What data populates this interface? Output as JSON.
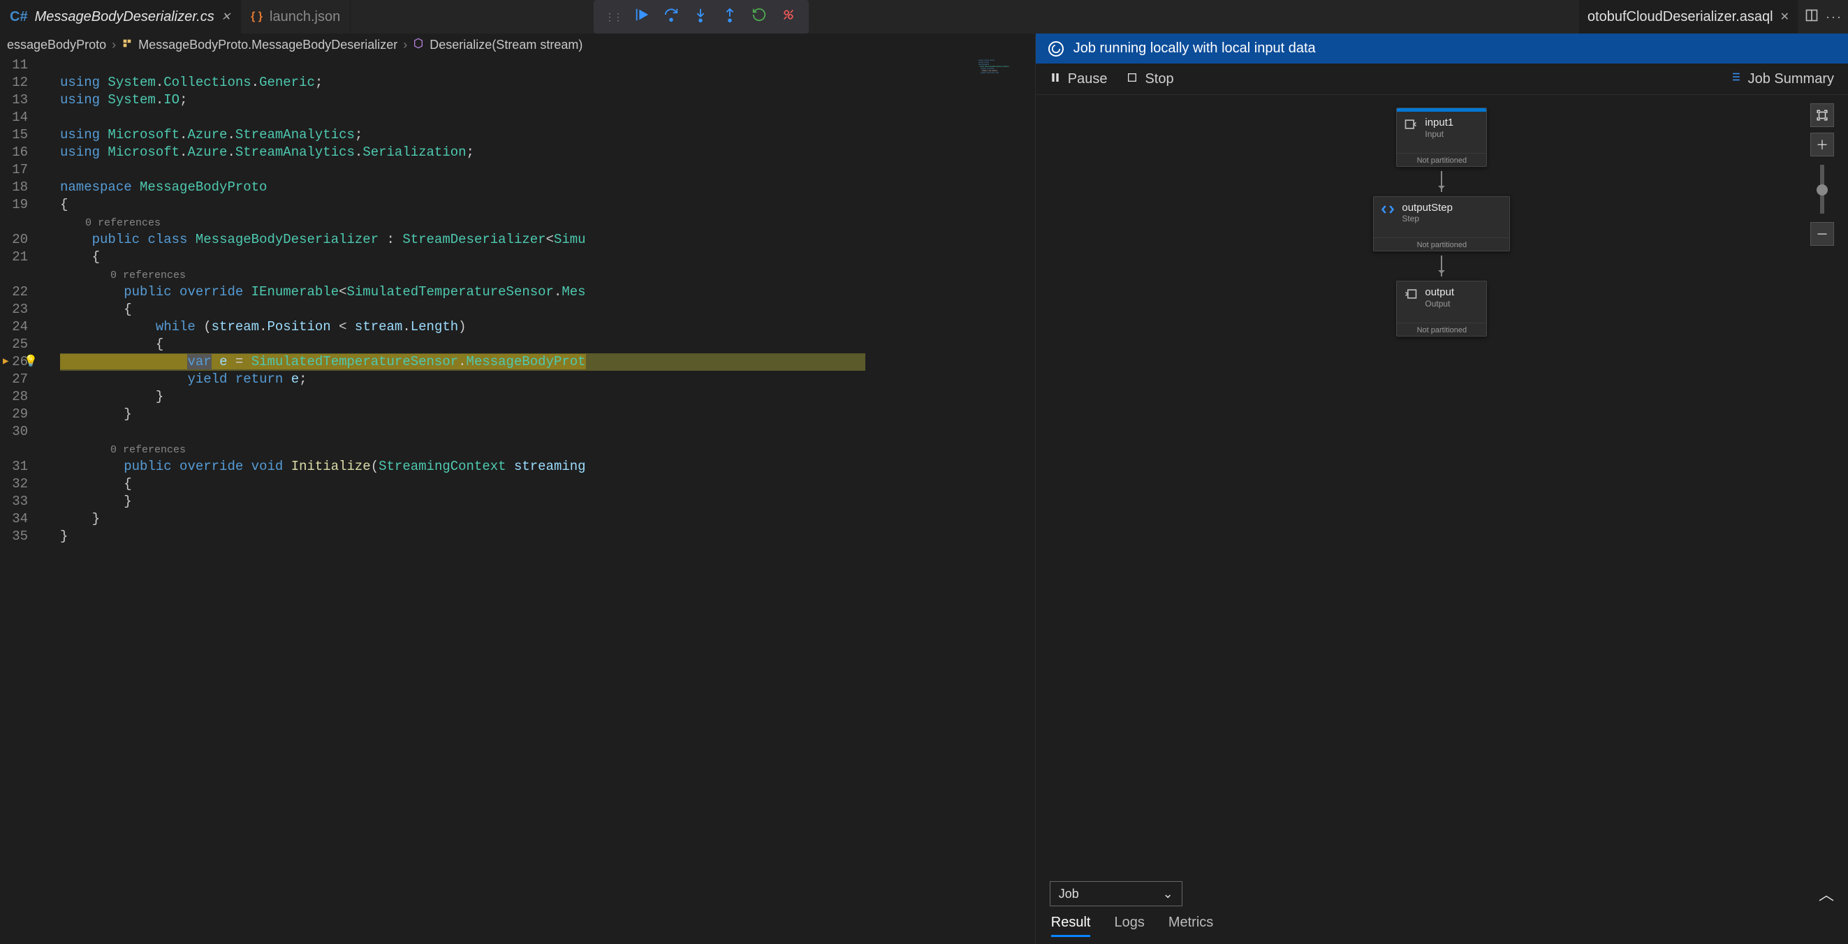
{
  "tabs": {
    "left": [
      {
        "label": "MessageBodyDeserializer.cs",
        "icon": "C#",
        "active": true,
        "closeable": true
      },
      {
        "label": "launch.json",
        "icon": "{ }",
        "active": false,
        "closeable": false
      }
    ],
    "right": {
      "label": "otobufCloudDeserializer.asaql",
      "closeable": true
    }
  },
  "breadcrumb": {
    "seg1": "essageBodyProto",
    "seg2": "MessageBodyProto.MessageBodyDeserializer",
    "seg3": "Deserialize(Stream stream)"
  },
  "editor": {
    "refs_label": "0 references",
    "lines": [
      {
        "n": 11,
        "t": ""
      },
      {
        "n": 12,
        "t": "using System.Collections.Generic;"
      },
      {
        "n": 13,
        "t": "using System.IO;"
      },
      {
        "n": 14,
        "t": ""
      },
      {
        "n": 15,
        "t": "using Microsoft.Azure.StreamAnalytics;"
      },
      {
        "n": 16,
        "t": "using Microsoft.Azure.StreamAnalytics.Serialization;"
      },
      {
        "n": 17,
        "t": ""
      },
      {
        "n": 18,
        "t": "namespace MessageBodyProto"
      },
      {
        "n": 19,
        "t": "{"
      },
      {
        "n": 20,
        "t": "    public class MessageBodyDeserializer : StreamDeserializer<Simu"
      },
      {
        "n": 21,
        "t": "    {"
      },
      {
        "n": 22,
        "t": "        public override IEnumerable<SimulatedTemperatureSensor.Mes"
      },
      {
        "n": 23,
        "t": "        {"
      },
      {
        "n": 24,
        "t": "            while (stream.Position < stream.Length)"
      },
      {
        "n": 25,
        "t": "            {"
      },
      {
        "n": 26,
        "t": "                var e = SimulatedTemperatureSensor.MessageBodyProt"
      },
      {
        "n": 27,
        "t": "                yield return e;"
      },
      {
        "n": 28,
        "t": "            }"
      },
      {
        "n": 29,
        "t": "        }"
      },
      {
        "n": 30,
        "t": ""
      },
      {
        "n": 31,
        "t": "        public override void Initialize(StreamingContext streaming"
      },
      {
        "n": 32,
        "t": "        {"
      },
      {
        "n": 33,
        "t": "        }"
      },
      {
        "n": 34,
        "t": "    }"
      },
      {
        "n": 35,
        "t": "}"
      }
    ],
    "current_line": 26
  },
  "job": {
    "banner": "Job running locally with local input data",
    "pause": "Pause",
    "stop": "Stop",
    "summary": "Job Summary",
    "nodes": {
      "input": {
        "title": "input1",
        "sub": "Input",
        "partition": "Not partitioned"
      },
      "step": {
        "title": "outputStep",
        "sub": "Step",
        "partition": "Not partitioned"
      },
      "output": {
        "title": "output",
        "sub": "Output",
        "partition": "Not partitioned"
      }
    },
    "select": "Job",
    "tabs": {
      "result": "Result",
      "logs": "Logs",
      "metrics": "Metrics"
    }
  }
}
